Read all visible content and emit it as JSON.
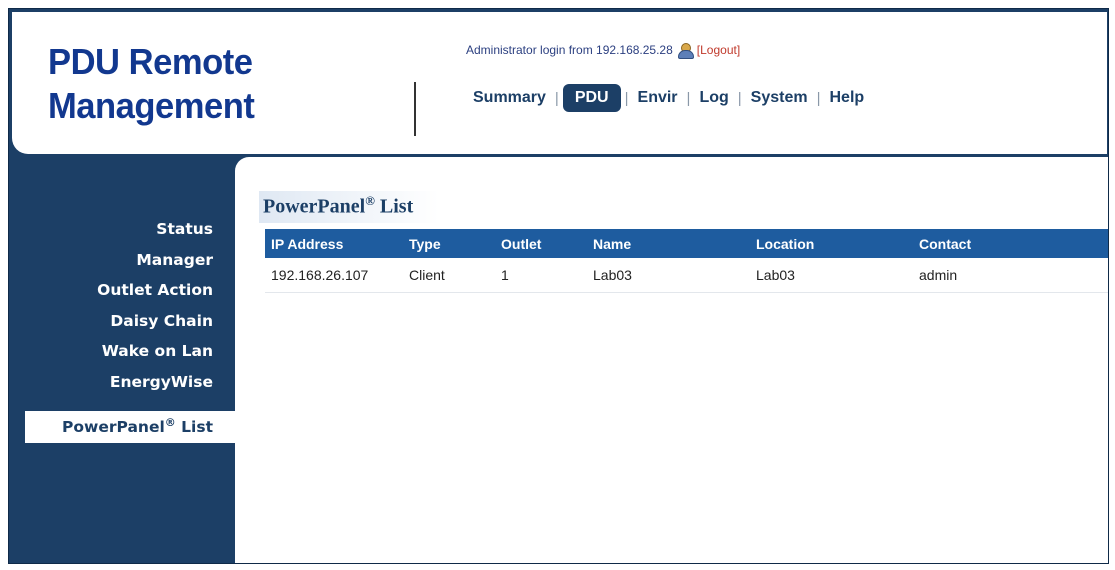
{
  "app": {
    "logo_line1": "PDU Remote",
    "logo_line2": "Management"
  },
  "header": {
    "login_text": "Administrator login from 192.168.25.28",
    "logout_label": "[Logout]"
  },
  "nav": {
    "items": [
      {
        "label": "Summary"
      },
      {
        "label": "PDU"
      },
      {
        "label": "Envir"
      },
      {
        "label": "Log"
      },
      {
        "label": "System"
      },
      {
        "label": "Help"
      }
    ],
    "active": "PDU",
    "separator": "|"
  },
  "sidebar": {
    "items": [
      {
        "label": "Status"
      },
      {
        "label": "Manager"
      },
      {
        "label": "Outlet Action"
      },
      {
        "label": "Daisy Chain"
      },
      {
        "label": "Wake on Lan"
      },
      {
        "label": "EnergyWise"
      }
    ],
    "active_label": "PowerPanel",
    "active_mark": "®",
    "active_suffix": " List"
  },
  "panel": {
    "title": "PowerPanel",
    "title_mark": "®",
    "title_suffix": " List"
  },
  "table": {
    "columns": [
      "IP Address",
      "Type",
      "Outlet",
      "Name",
      "Location",
      "Contact"
    ],
    "rows": [
      [
        "192.168.26.107",
        "Client",
        "1",
        "Lab03",
        "Lab03",
        "admin"
      ]
    ]
  },
  "colors": {
    "frame": "#1c3f66",
    "logo": "#12388f",
    "table_header": "#1e5c9f",
    "logout": "#c0392b"
  },
  "icons": {
    "user": "user-icon"
  }
}
